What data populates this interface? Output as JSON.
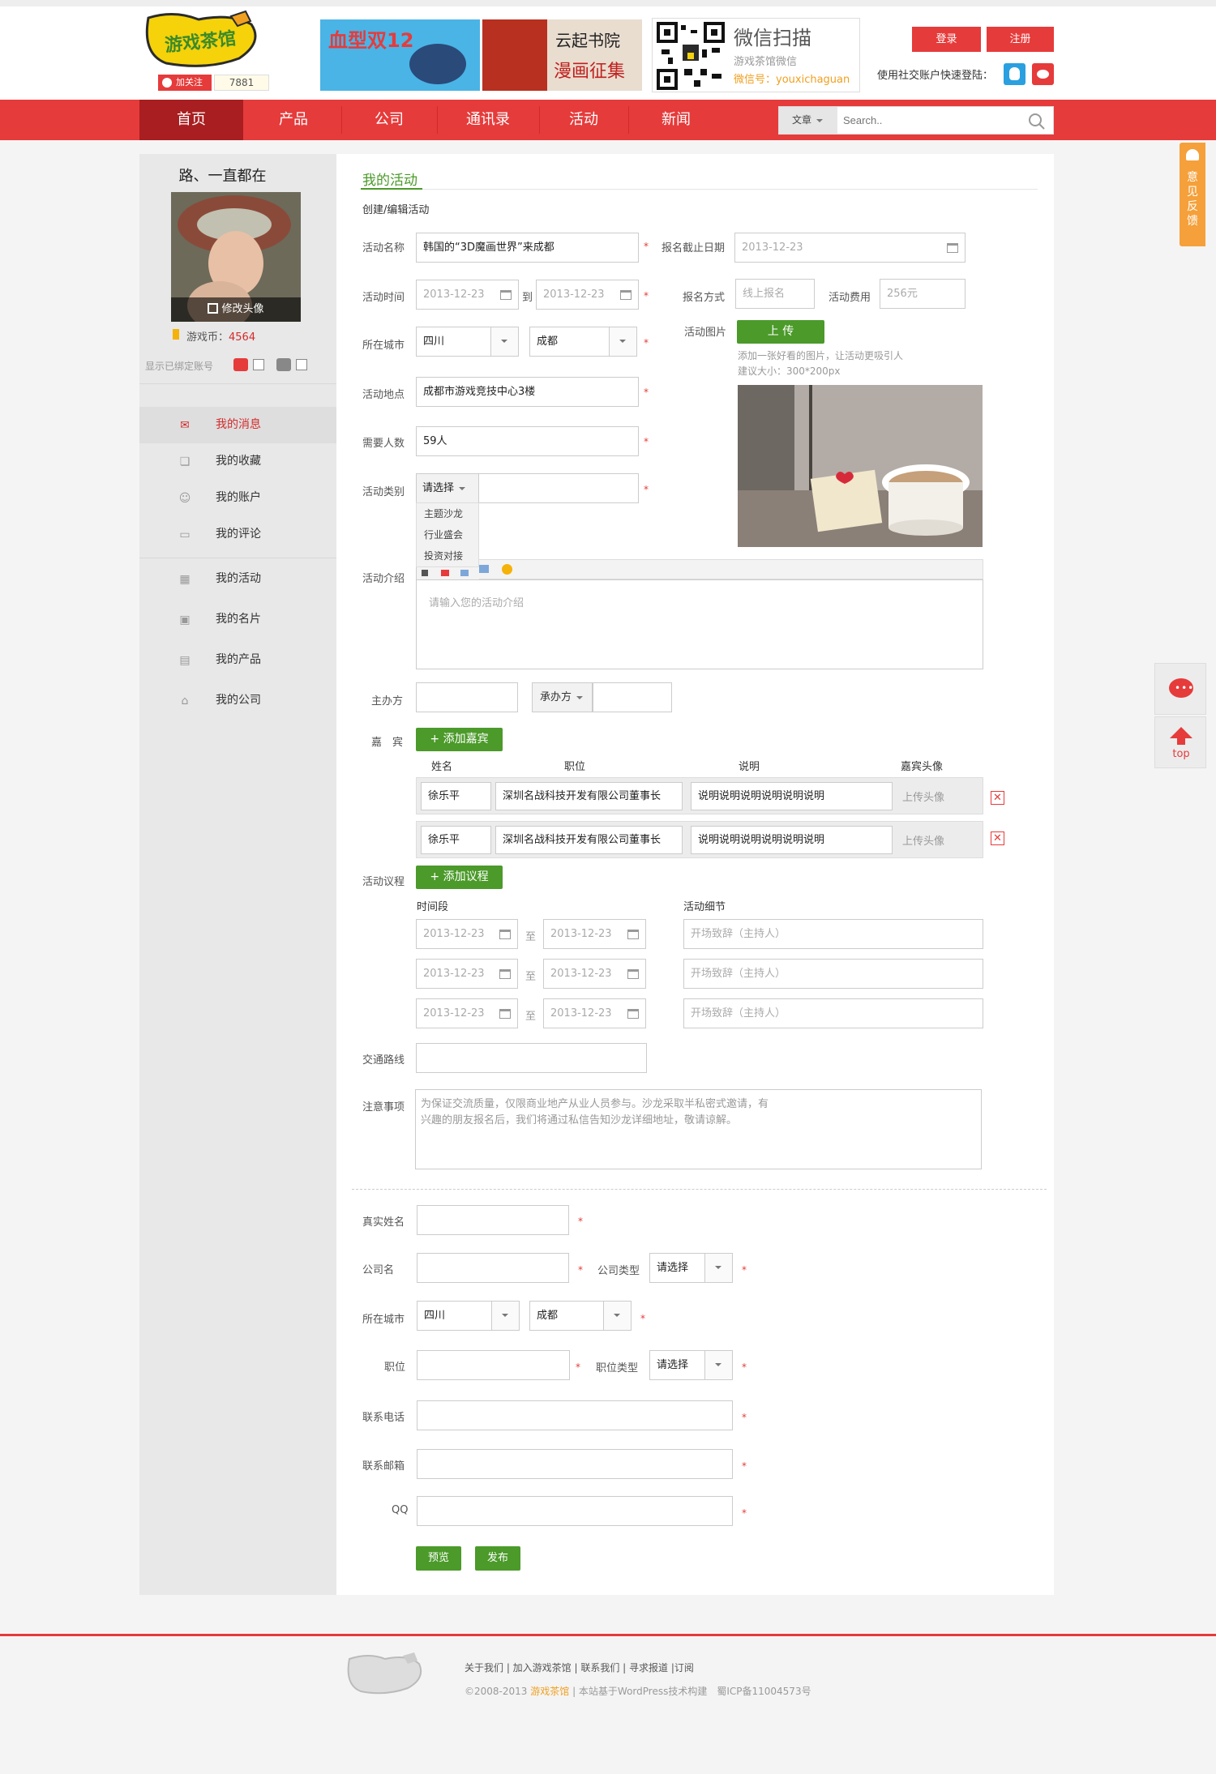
{
  "header": {
    "logo_text": "游戏茶馆",
    "follow_label": "加关注",
    "follow_count": "7881",
    "ad1_text": "血型双12",
    "ad2_line1": "云起书院",
    "ad2_line2": "漫画征集",
    "wechat_title": "微信扫描",
    "wechat_sub": "游戏茶馆微信",
    "wechat_id": "微信号：youxichaguan",
    "login_label": "登录",
    "register_label": "注册",
    "social_login_text": "使用社交账户快速登陆："
  },
  "nav": {
    "items": [
      "首页",
      "产品",
      "公司",
      "通讯录",
      "活动",
      "新闻"
    ],
    "search_category": "文章",
    "search_placeholder": "Search..",
    "brand_color": "#e63b3b"
  },
  "feedback": {
    "label": "意见反馈"
  },
  "sidebar": {
    "username": "路、一直都在",
    "change_avatar": "修改头像",
    "coin_label": "游戏币：",
    "coin_value": "4564",
    "bound_accounts": "显示已绑定账号",
    "items": [
      {
        "label": "我的消息",
        "icon": "mail-icon"
      },
      {
        "label": "我的收藏",
        "icon": "bookmark-icon"
      },
      {
        "label": "我的账户",
        "icon": "account-icon"
      },
      {
        "label": "我的评论",
        "icon": "comment-icon"
      },
      {
        "label": "我的活动",
        "icon": "calendar-icon"
      },
      {
        "label": "我的名片",
        "icon": "card-icon"
      },
      {
        "label": "我的产品",
        "icon": "product-icon"
      },
      {
        "label": "我的公司",
        "icon": "home-icon"
      }
    ]
  },
  "form": {
    "section_title": "我的活动",
    "subtitle": "创建/编辑活动",
    "name_label": "活动名称",
    "name_value": "韩国的“3D魔画世界”来成都",
    "deadline_label": "报名截止日期",
    "deadline_value": "2013-12-23",
    "time_label": "活动时间",
    "time_from": "2013-12-23",
    "time_to_word": "到",
    "time_to": "2013-12-23",
    "signup_label": "报名方式",
    "signup_value": "线上报名",
    "fee_label": "活动费用",
    "fee_value": "256元",
    "city_label": "所在城市",
    "province_value": "四川",
    "city_value": "成都",
    "image_label": "活动图片",
    "upload_label": "上 传",
    "image_hint1": "添加一张好看的图片，让活动更吸引人",
    "image_hint2": "建议大小：300*200px",
    "place_label": "活动地点",
    "place_value": "成都市游戏竞技中心3楼",
    "people_label": "需要人数",
    "people_value": "59人",
    "category_label": "活动类别",
    "category_select": "请选择",
    "category_options": [
      "主题沙龙",
      "行业盛会",
      "投资对接"
    ],
    "intro_label": "活动介绍",
    "intro_placeholder": "请输入您的活动介绍",
    "host_label": "主办方",
    "co_host_label": "承办方",
    "guests_label": "嘉　宾",
    "add_guest": "+ 添加嘉宾",
    "guest_headers": [
      "姓名",
      "职位",
      "说明",
      "嘉宾头像"
    ],
    "guests": [
      {
        "name": "徐乐平",
        "title": "深圳名战科技开发有限公司董事长",
        "desc": "说明说明说明说明说明说明",
        "avatar": "上传头像"
      },
      {
        "name": "徐乐平",
        "title": "深圳名战科技开发有限公司董事长",
        "desc": "说明说明说明说明说明说明",
        "avatar": "上传头像"
      }
    ],
    "agenda_label": "活动议程",
    "add_agenda": "+ 添加议程",
    "agenda_headers": [
      "时间段",
      "活动细节"
    ],
    "agenda": [
      {
        "from": "2013-12-23",
        "to": "2013-12-23",
        "detail": "开场致辞（主持人）"
      },
      {
        "from": "2013-12-23",
        "to": "2013-12-23",
        "detail": "开场致辞（主持人）"
      },
      {
        "from": "2013-12-23",
        "to": "2013-12-23",
        "detail": "开场致辞（主持人）"
      }
    ],
    "agenda_to_word": "至",
    "traffic_label": "交通路线",
    "notice_label": "注意事项",
    "notice_line1": "为保证交流质量，仅限商业地产从业人员参与。沙龙采取半私密式邀请，有",
    "notice_line2": "兴趣的朋友报名后，我们将通过私信告知沙龙详细地址，敬请谅解。"
  },
  "contact": {
    "realname_label": "真实姓名",
    "company_label": "公司名",
    "company_type_label": "公司类型",
    "company_type_value": "请选择",
    "city_label": "所在城市",
    "province_value": "四川",
    "city_value": "成都",
    "position_label": "职位",
    "position_type_label": "职位类型",
    "position_type_value": "请选择",
    "phone_label": "联系电话",
    "email_label": "联系邮箱",
    "qq_label": "QQ",
    "preview_button": "预览",
    "publish_button": "发布"
  },
  "floats": {
    "top_label": "top"
  },
  "footer": {
    "links": "关于我们 | 加入游戏茶馆 | 联系我们 | 寻求报道 |订阅",
    "copyright_prefix": "©2008-2013 ",
    "copyright_brand": "游戏茶馆",
    "copyright_suffix": " | 本站基于WordPress技术构建　蜀ICP备11004573号"
  }
}
